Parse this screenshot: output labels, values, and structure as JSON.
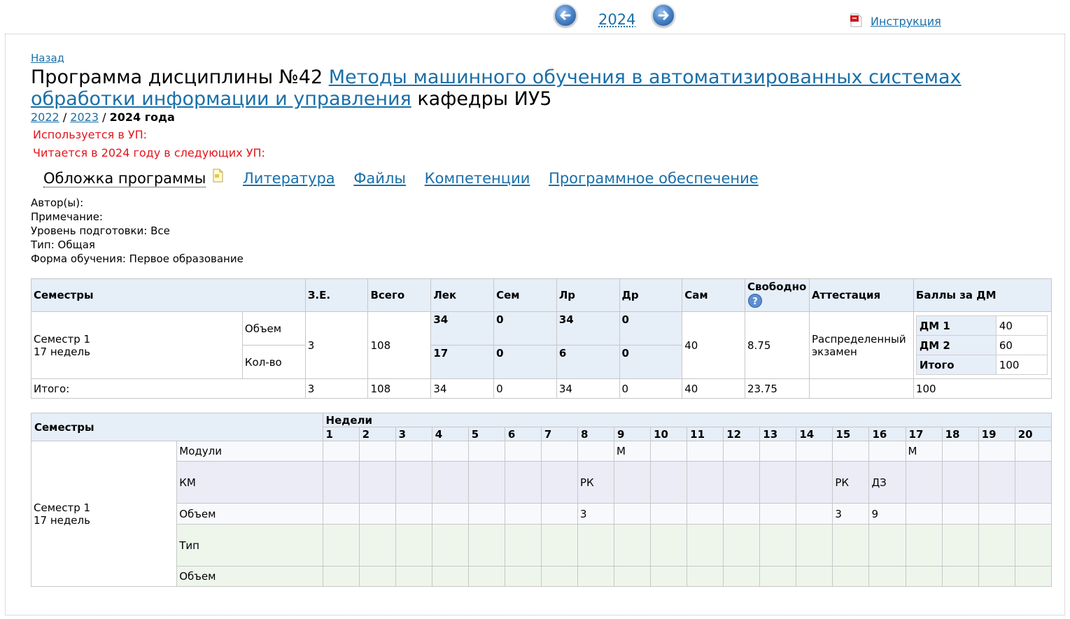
{
  "topbar": {
    "year": "2024",
    "instruction": "Инструкция"
  },
  "nav": {
    "back": "Назад"
  },
  "title": {
    "prefix": "Программа дисциплины №42",
    "link": "Методы машинного обучения в автоматизированных системах обработки информации и управления",
    "suffix": "кафедры ИУ5"
  },
  "years": {
    "y1": "2022",
    "y2": "2023",
    "current": "2024 года"
  },
  "used_in": "Используется в УП:",
  "read_in": "Читается в 2024 году в следующих УП:",
  "tabs": {
    "cover": "Обложка программы",
    "literature": "Литература",
    "files": "Файлы",
    "competencies": "Компетенции",
    "software": "Программное обеспечение"
  },
  "meta": {
    "authors": "Автор(ы):",
    "note": "Примечание:",
    "level": "Уровень подготовки: Все",
    "type": "Тип: Общая",
    "form": "Форма обучения: Первое образование"
  },
  "table1": {
    "headers": {
      "semesters": "Семестры",
      "ze": "З.Е.",
      "total": "Всего",
      "lek": "Лек",
      "sem": "Сем",
      "lr": "Лр",
      "dr": "Др",
      "sam": "Сам",
      "free": "Свободно",
      "att": "Аттестация",
      "points": "Баллы за ДМ"
    },
    "semester": {
      "name": "Семестр 1",
      "weeks": "17 недель",
      "vol_label": "Объем",
      "cnt_label": "Кол-во",
      "ze": "3",
      "total": "108",
      "lek_v": "34",
      "sem_v": "0",
      "lr_v": "34",
      "dr_v": "0",
      "lek_c": "17",
      "sem_c": "0",
      "lr_c": "6",
      "dr_c": "0",
      "sam": "40",
      "free": "8.75",
      "att": "Распределенный экзамен"
    },
    "dm": {
      "dm1_label": "ДМ 1",
      "dm1": "40",
      "dm2_label": "ДМ 2",
      "dm2": "60",
      "total_label": "Итого",
      "total": "100"
    },
    "totals": {
      "label": "Итого:",
      "ze": "3",
      "total": "108",
      "lek": "34",
      "sem": "0",
      "lr": "34",
      "dr": "0",
      "sam": "40",
      "free": "23.75",
      "att": "",
      "points": "100"
    }
  },
  "table2": {
    "semesters_header": "Семестры",
    "weeks_header": "Недели",
    "weeks": [
      "1",
      "2",
      "3",
      "4",
      "5",
      "6",
      "7",
      "8",
      "9",
      "10",
      "11",
      "12",
      "13",
      "14",
      "15",
      "16",
      "17",
      "18",
      "19",
      "20"
    ],
    "semester_name": "Семестр 1",
    "semester_weeks": "17 недель",
    "rows": [
      {
        "label": "Модули",
        "cells": [
          "",
          "",
          "",
          "",
          "",
          "",
          "",
          "",
          "М",
          "",
          "",
          "",
          "",
          "",
          "",
          "",
          "М",
          "",
          "",
          ""
        ]
      },
      {
        "label": "КМ",
        "cells": [
          "",
          "",
          "",
          "",
          "",
          "",
          "",
          "РК",
          "",
          "",
          "",
          "",
          "",
          "",
          "РК",
          "ДЗ",
          "",
          "",
          "",
          ""
        ]
      },
      {
        "label": "Объем",
        "cells": [
          "",
          "",
          "",
          "",
          "",
          "",
          "",
          "3",
          "",
          "",
          "",
          "",
          "",
          "",
          "3",
          "9",
          "",
          "",
          "",
          ""
        ]
      },
      {
        "label": "Тип",
        "cells": [
          "",
          "",
          "",
          "",
          "",
          "",
          "",
          "",
          "",
          "",
          "",
          "",
          "",
          "",
          "",
          "",
          "",
          "",
          "",
          ""
        ]
      },
      {
        "label": "Объем",
        "cells": [
          "",
          "",
          "",
          "",
          "",
          "",
          "",
          "",
          "",
          "",
          "",
          "",
          "",
          "",
          "",
          "",
          "",
          "",
          "",
          ""
        ]
      }
    ]
  },
  "colors": {
    "link": "#1a6fa8",
    "red": "#e3141b",
    "header_bg": "#e6eef8"
  }
}
